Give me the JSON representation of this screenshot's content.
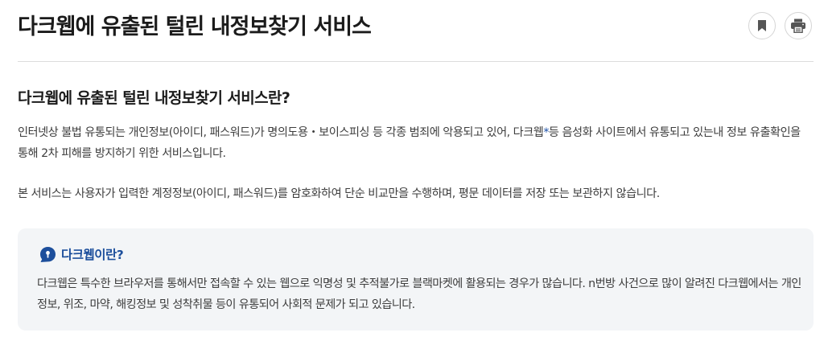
{
  "header": {
    "title": "다크웹에 유출된 털린 내정보찾기 서비스",
    "bookmark_icon": "bookmark-icon",
    "print_icon": "printer-icon"
  },
  "intro": {
    "title": "다크웹에 유출된 털린 내정보찾기 서비스란?",
    "paragraph1_before": "인터넷상 불법 유통되는 개인정보(아이디, 패스워드)가 명의도용・보이스피싱 등 각종 범죄에 악용되고 있어, 다크웹",
    "paragraph1_mark": "*",
    "paragraph1_after": "등 음성화 사이트에서 유통되고 있는내 정보 유출확인을 통해 2차 피해를 방지하기 위한 서비스입니다.",
    "paragraph2": "본 서비스는 사용자가 입력한 계정정보(아이디, 패스워드)를 암호화하여 단순 비교만을 수행하며, 평문 데이터를 저장 또는 보관하지 않습니다."
  },
  "info_box": {
    "icon": "lock-bubble-icon",
    "title": "다크웹이란?",
    "text": "다크웹은 특수한 브라우저를 통해서만 접속할 수 있는 웹으로 익명성 및 추적불가로 블랙마켓에 활용되는 경우가 많습니다. n번방 사건으로 많이 알려진 다크웹에서는 개인정보, 위조, 마약, 해킹정보 및 성착취물 등이 유통되어 사회적 문제가 되고 있습니다."
  },
  "colors": {
    "accent": "#1d4f9c",
    "box_bg": "#f3f5f7",
    "icon_gray": "#555555"
  }
}
